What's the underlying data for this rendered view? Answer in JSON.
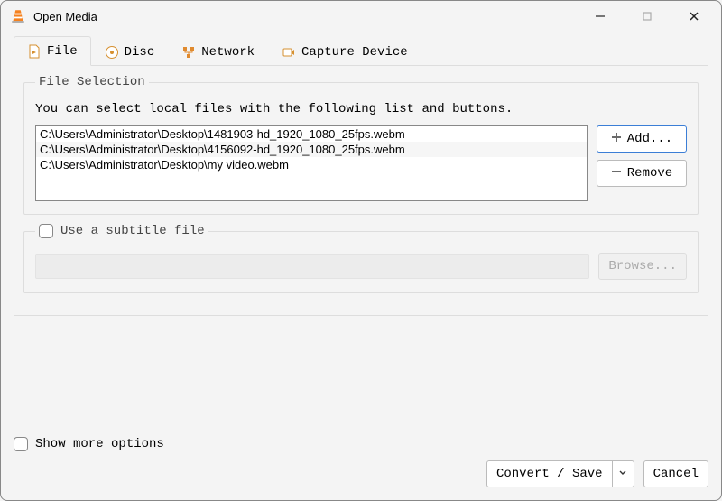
{
  "window": {
    "title": "Open Media"
  },
  "tabs": {
    "file": "File",
    "disc": "Disc",
    "network": "Network",
    "capture": "Capture Device"
  },
  "fileSelection": {
    "legend": "File Selection",
    "help": "You can select local files with the following list and buttons.",
    "files": [
      "C:\\Users\\Administrator\\Desktop\\1481903-hd_1920_1080_25fps.webm",
      "C:\\Users\\Administrator\\Desktop\\4156092-hd_1920_1080_25fps.webm",
      "C:\\Users\\Administrator\\Desktop\\my video.webm"
    ],
    "addLabel": "Add...",
    "removeLabel": "Remove"
  },
  "subtitle": {
    "label": "Use a subtitle file",
    "browseLabel": "Browse..."
  },
  "footer": {
    "showMore": "Show more options",
    "convert": "Convert / Save",
    "cancel": "Cancel"
  }
}
